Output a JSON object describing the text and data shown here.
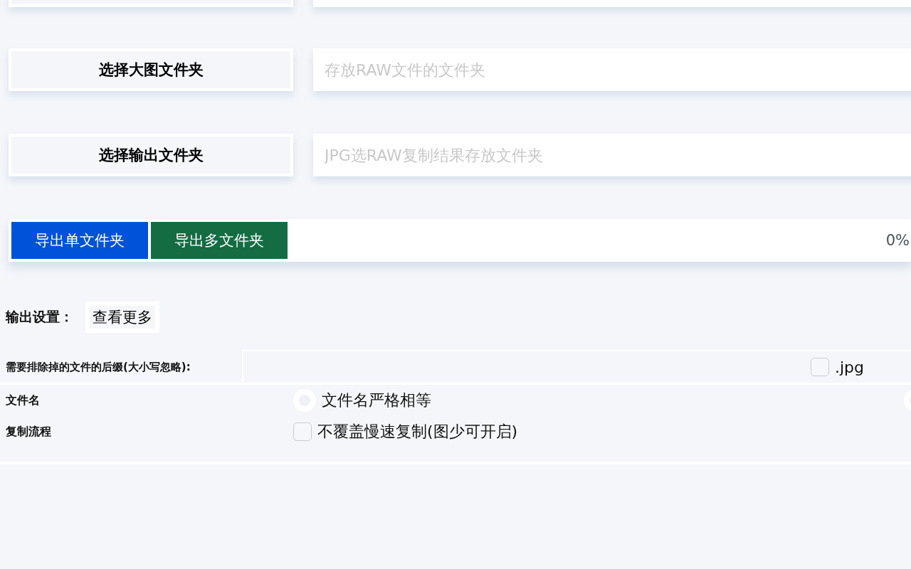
{
  "folder_rows": [
    {
      "button": "选择大图文件夹",
      "placeholder": "存放RAW文件的文件夹"
    },
    {
      "button": "选择输出文件夹",
      "placeholder": "JPG选RAW复制结果存放文件夹"
    }
  ],
  "export": {
    "buttons": [
      {
        "label": "导出单文件夹",
        "kind": "primary"
      },
      {
        "label": "导出多文件夹",
        "kind": "success"
      }
    ],
    "progress": {
      "level": 0,
      "reading": "0%"
    }
  },
  "settings": {
    "title": "输出设置：",
    "more_button": "查看更多",
    "suffix": {
      "label": "需要排除掉的文件的后缀(大小写忽略):",
      "options": [
        {
          "label": ".jpg",
          "checked": false
        }
      ]
    },
    "file_name": {
      "label": "文件名",
      "options": [
        {
          "label": "文件名严格相等",
          "selected": false
        },
        {
          "selected": false
        }
      ]
    },
    "copy_flow": {
      "label": "复制流程",
      "options": [
        {
          "label": "不覆盖慢速复制(图少可开启)",
          "checked": false
        }
      ]
    }
  }
}
